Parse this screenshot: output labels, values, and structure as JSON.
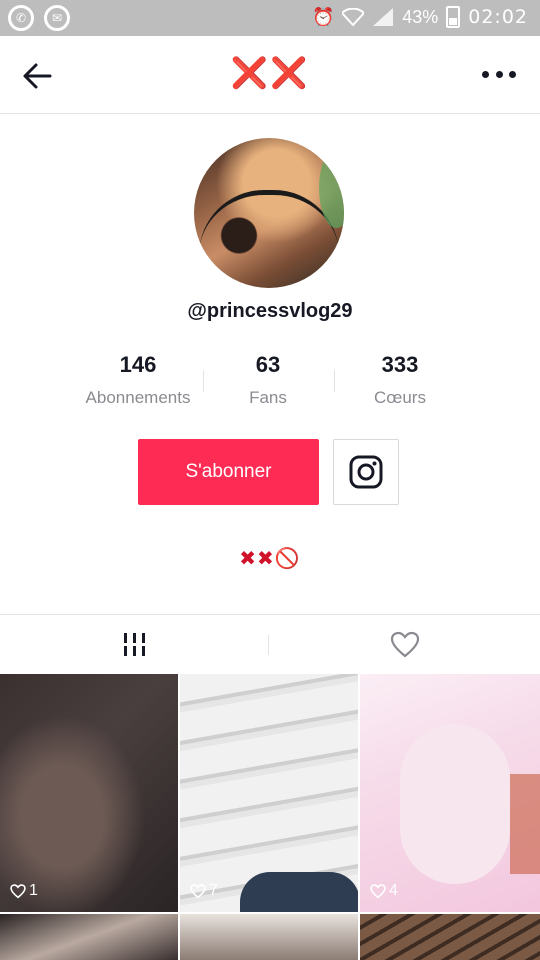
{
  "status_bar": {
    "battery": "43%",
    "time": "02:02"
  },
  "header": {
    "title": "❌❌"
  },
  "profile": {
    "username": "@princessvlog29",
    "stats": [
      {
        "value": "146",
        "label": "Abonnements"
      },
      {
        "value": "63",
        "label": "Fans"
      },
      {
        "value": "333",
        "label": "Cœurs"
      }
    ],
    "follow_label": "S'abonner",
    "bio": "✖✖🚫"
  },
  "videos": [
    {
      "likes": "1"
    },
    {
      "likes": "7"
    },
    {
      "likes": "4"
    }
  ],
  "colors": {
    "accent": "#fe2c55",
    "emoji_red": "#d0112b"
  }
}
